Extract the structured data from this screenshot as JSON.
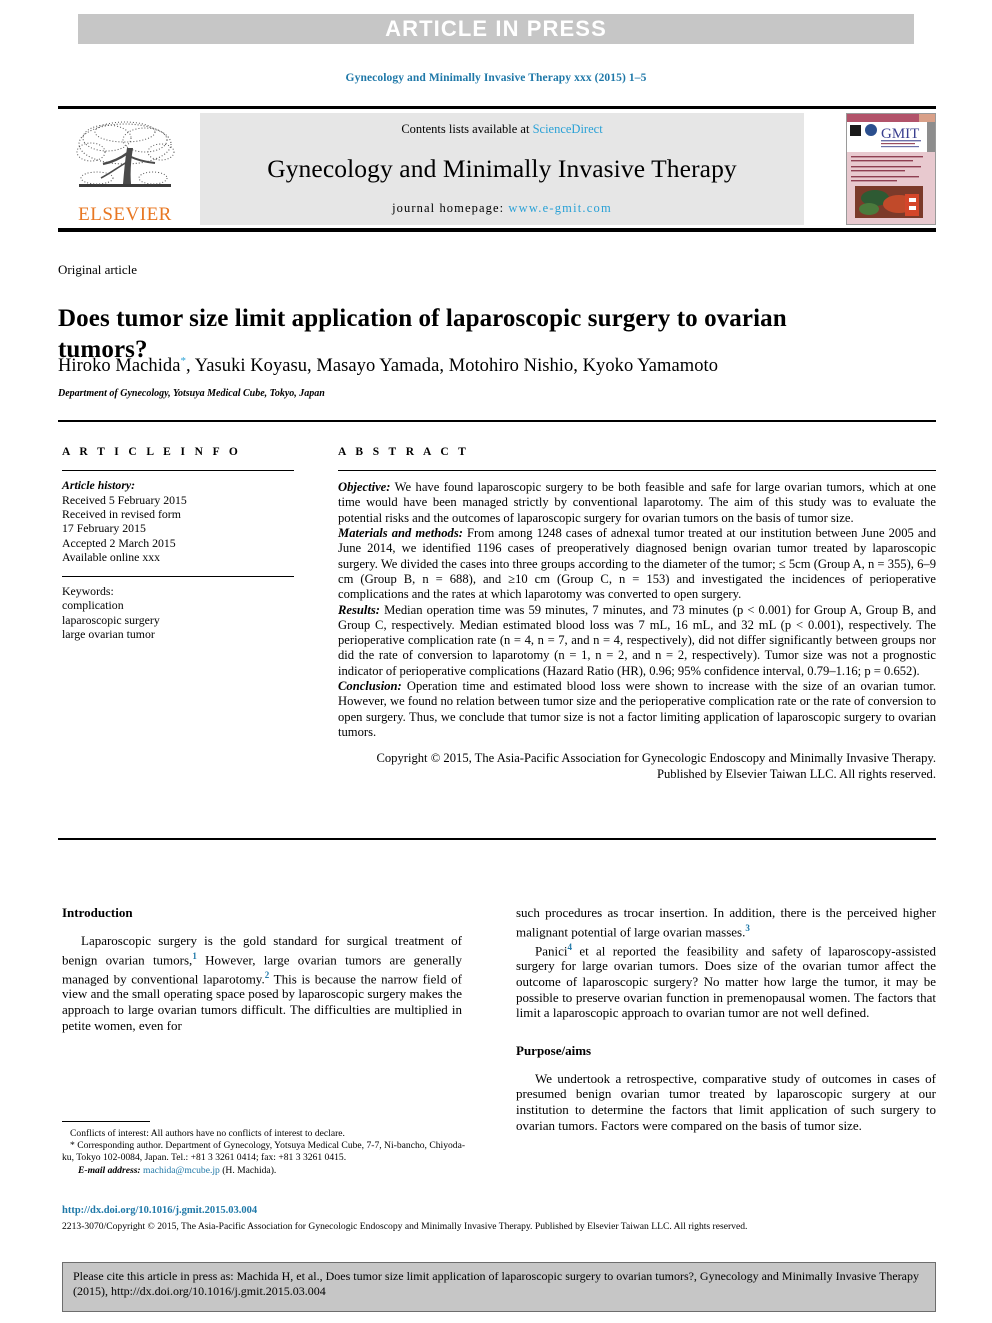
{
  "banner": {
    "text": "ARTICLE IN PRESS"
  },
  "running_head": "Gynecology and Minimally Invasive Therapy xxx (2015) 1–5",
  "masthead": {
    "publisher": "ELSEVIER",
    "contents_prefix": "Contents lists available at ",
    "contents_link": "ScienceDirect",
    "journal_title": "Gynecology and Minimally Invasive Therapy",
    "homepage_prefix": "journal homepage: ",
    "homepage_url": "www.e-gmit.com",
    "cover_title": "GMIT"
  },
  "article": {
    "type": "Original article",
    "title": "Does tumor size limit application of laparoscopic surgery to ovarian tumors?",
    "authors": "Hiroko Machida, Yasuki Koyasu, Masayo Yamada, Motohiro Nishio, Kyoko Yamamoto",
    "author_marker": "*",
    "affiliation": "Department of Gynecology, Yotsuya Medical Cube, Tokyo, Japan"
  },
  "info": {
    "heading": "A R T I C L E   I N F O",
    "history_label": "Article history:",
    "history": [
      "Received 5 February 2015",
      "Received in revised form",
      "17 February 2015",
      "Accepted 2 March 2015",
      "Available online xxx"
    ],
    "keywords_label": "Keywords:",
    "keywords": [
      "complication",
      "laparoscopic surgery",
      "large ovarian tumor"
    ]
  },
  "abstract": {
    "heading": "A B S T R A C T",
    "objective_label": "Objective:",
    "objective": " We have found laparoscopic surgery to be both feasible and safe for large ovarian tumors, which at one time would have been managed strictly by conventional laparotomy. The aim of this study was to evaluate the potential risks and the outcomes of laparoscopic surgery for ovarian tumors on the basis of tumor size.",
    "methods_label": "Materials and methods:",
    "methods": "  From among 1248 cases of adnexal tumor treated at our institution between June 2005 and June 2014, we identified 1196 cases of preoperatively diagnosed benign ovarian tumor treated by laparoscopic surgery. We divided the cases into three groups according to the diameter of the tumor; ≤ 5cm (Group A, n = 355), 6–9 cm (Group B, n = 688), and ≥10 cm (Group C, n = 153) and investigated the incidences of perioperative complications and the rates at which laparotomy was converted to open surgery.",
    "results_label": "Results:",
    "results": " Median operation time was 59 minutes, 7 minutes, and 73 minutes (p < 0.001) for Group A, Group B, and Group C, respectively. Median estimated blood loss was 7 mL, 16 mL, and 32 mL (p < 0.001), respectively. The perioperative complication rate (n = 4, n = 7, and n = 4, respectively), did not differ significantly between groups nor did the rate of conversion to laparotomy (n = 1, n = 2, and n = 2, respectively). Tumor size was not a prognostic indicator of perioperative complications (Hazard Ratio (HR), 0.96; 95% confidence interval, 0.79–1.16; p = 0.652).",
    "conclusion_label": "Conclusion:",
    "conclusion": " Operation time and estimated blood loss were shown to increase with the size of an ovarian tumor. However, we found no relation between tumor size and the perioperative complication rate or the rate of conversion to open surgery. Thus, we conclude that tumor size is not a factor limiting application of laparoscopic surgery to ovarian tumors.",
    "copyright": "Copyright © 2015, The Asia-Pacific Association for Gynecologic Endoscopy and Minimally Invasive Therapy. Published by Elsevier Taiwan LLC. All rights reserved."
  },
  "body": {
    "intro_heading": "Introduction",
    "intro_p1_a": "Laparoscopic surgery is the gold standard for surgical treatment of benign ovarian tumors,",
    "intro_p1_ref1": "1",
    "intro_p1_b": " However, large ovarian tumors are generally managed by conventional laparotomy.",
    "intro_p1_ref2": "2",
    "intro_p1_c": " This is because the narrow field of view and the small operating space posed by laparoscopic surgery makes the approach to large ovarian tumors difficult. The difficulties are multiplied in petite women, even for",
    "right_p1_a": "such procedures as trocar insertion. In addition, there is the perceived higher malignant potential of large ovarian masses.",
    "right_p1_ref3": "3",
    "right_p2_name": "Panici",
    "right_p2_ref4": "4",
    "right_p2_b": " et al reported the feasibility and safety of laparoscopy-assisted surgery for large ovarian tumors. Does size of the ovarian tumor affect the outcome of laparoscopic surgery? No matter how large the tumor, it may be possible to preserve ovarian function in premenopausal women. The factors that limit a laparoscopic approach to ovarian tumor are not well defined.",
    "purpose_heading": "Purpose/aims",
    "purpose_p1": "We undertook a retrospective, comparative study of outcomes in cases of presumed benign ovarian tumor treated by laparoscopic surgery at our institution to determine the factors that limit application of such surgery to ovarian tumors. Factors were compared on the basis of tumor size."
  },
  "footnotes": {
    "conflicts": "Conflicts of interest: All authors have no conflicts of interest to declare.",
    "corresponding": "* Corresponding author. Department of Gynecology, Yotsuya Medical Cube, 7-7, Ni-bancho, Chiyoda-ku, Tokyo 102-0084, Japan. Tel.: +81 3 3261 0414; fax: +81 3 3261 0415.",
    "email_label": "E-mail address:",
    "email": "machida@mcube.jp",
    "email_suffix": " (H. Machida).",
    "doi": "http://dx.doi.org/10.1016/j.gmit.2015.03.004",
    "issn_copyright": "2213-3070/Copyright © 2015, The Asia-Pacific Association for Gynecologic Endoscopy and Minimally Invasive Therapy. Published by Elsevier Taiwan LLC. All rights reserved."
  },
  "citation_box": {
    "text": "Please cite this article in press as: Machida H, et al., Does tumor size limit application of laparoscopic surgery to ovarian tumors?, Gynecology and Minimally Invasive Therapy (2015), http://dx.doi.org/10.1016/j.gmit.2015.03.004"
  },
  "colors": {
    "banner_bg": "#c6c6c6",
    "link_blue": "#2aa1d6",
    "runhead_blue": "#1f78a8",
    "elsevier_orange": "#e87722",
    "panel_grey": "#e6e6e6"
  }
}
